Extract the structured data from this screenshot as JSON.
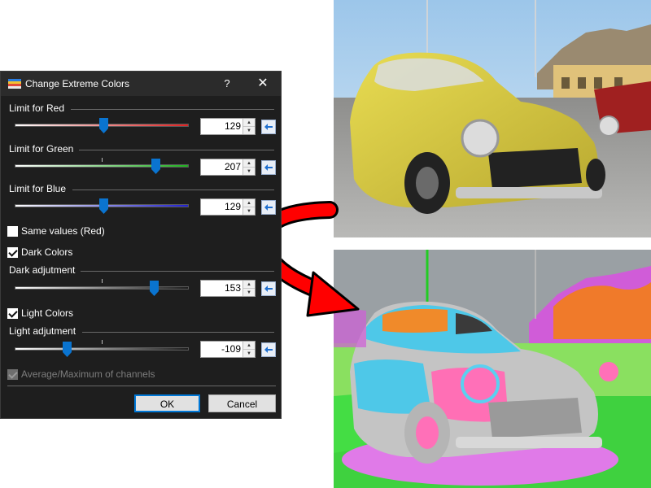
{
  "dialog": {
    "title": "Change Extreme Colors",
    "help_label": "?",
    "close_label": "✕",
    "icon": "app-palette-icon",
    "ok_label": "OK",
    "cancel_label": "Cancel"
  },
  "sliders": [
    {
      "label": "Limit for Red",
      "value": "129",
      "fraction": 0.51,
      "color": "#e02020"
    },
    {
      "label": "Limit for Green",
      "value": "207",
      "fraction": 0.81,
      "color": "#20b020"
    },
    {
      "label": "Limit for Blue",
      "value": "129",
      "fraction": 0.51,
      "color": "#2020d0"
    },
    {
      "label": "Dark adjutment",
      "value": "153",
      "fraction": 0.8,
      "color": "#1e1e1e"
    },
    {
      "label": "Light adjutment",
      "value": "-109",
      "fraction": 0.3,
      "color": "#1e1e1e"
    }
  ],
  "checkboxes": {
    "same_values": {
      "label": "Same values (Red)",
      "checked": false
    },
    "dark_colors": {
      "label": "Dark Colors",
      "checked": true
    },
    "light_colors": {
      "label": "Light Colors",
      "checked": true
    },
    "average_max": {
      "label": "Average/Maximum of channels",
      "checked": true,
      "disabled": true
    }
  },
  "colors": {
    "accent": "#0078d7",
    "thumb": "#0a74d0",
    "arrow": "#ff0000",
    "dialog_bg": "#1e1e1e"
  }
}
